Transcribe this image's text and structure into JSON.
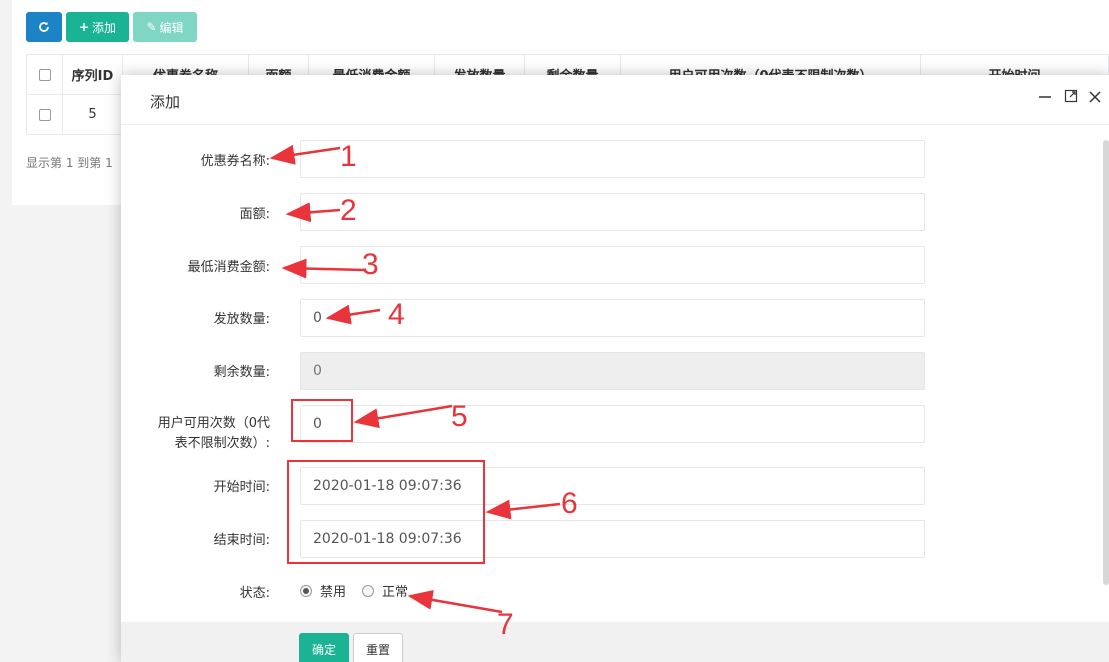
{
  "toolbar": {
    "refresh_icon": "refresh-icon",
    "add_label": "添加",
    "edit_label": "编辑"
  },
  "table": {
    "headers": [
      "序列ID",
      "优惠券名称",
      "面额",
      "最低消费金额",
      "发放数量",
      "剩余数量",
      "用户可用次数（0代表不限制次数）",
      "开始时间"
    ],
    "rows": [
      {
        "id": "5"
      }
    ],
    "footer": "显示第 1 到第 1"
  },
  "modal": {
    "title": "添加",
    "header_icons": [
      "minimize-icon",
      "maximize-icon",
      "close-icon"
    ],
    "fields": [
      {
        "label": "优惠券名称:",
        "value": ""
      },
      {
        "label": "面额:",
        "value": ""
      },
      {
        "label": "最低消费金额:",
        "value": ""
      },
      {
        "label": "发放数量:",
        "value": "0"
      },
      {
        "label": "剩余数量:",
        "value": "0"
      },
      {
        "label_line1": "用户可用次数（0代",
        "label_line2": "表不限制次数）:",
        "value": "0"
      },
      {
        "label": "开始时间:",
        "value": "2020-01-18 09:07:36"
      },
      {
        "label": "结束时间:",
        "value": "2020-01-18 09:07:36"
      }
    ],
    "status": {
      "label": "状态:",
      "options": [
        {
          "label": "禁用",
          "checked": true
        },
        {
          "label": "正常",
          "checked": false
        }
      ]
    },
    "buttons": {
      "ok": "确定",
      "reset": "重置"
    }
  },
  "annotations": {
    "color": "#e8343a",
    "numbers": [
      "1",
      "2",
      "3",
      "4",
      "5",
      "6",
      "7"
    ]
  }
}
